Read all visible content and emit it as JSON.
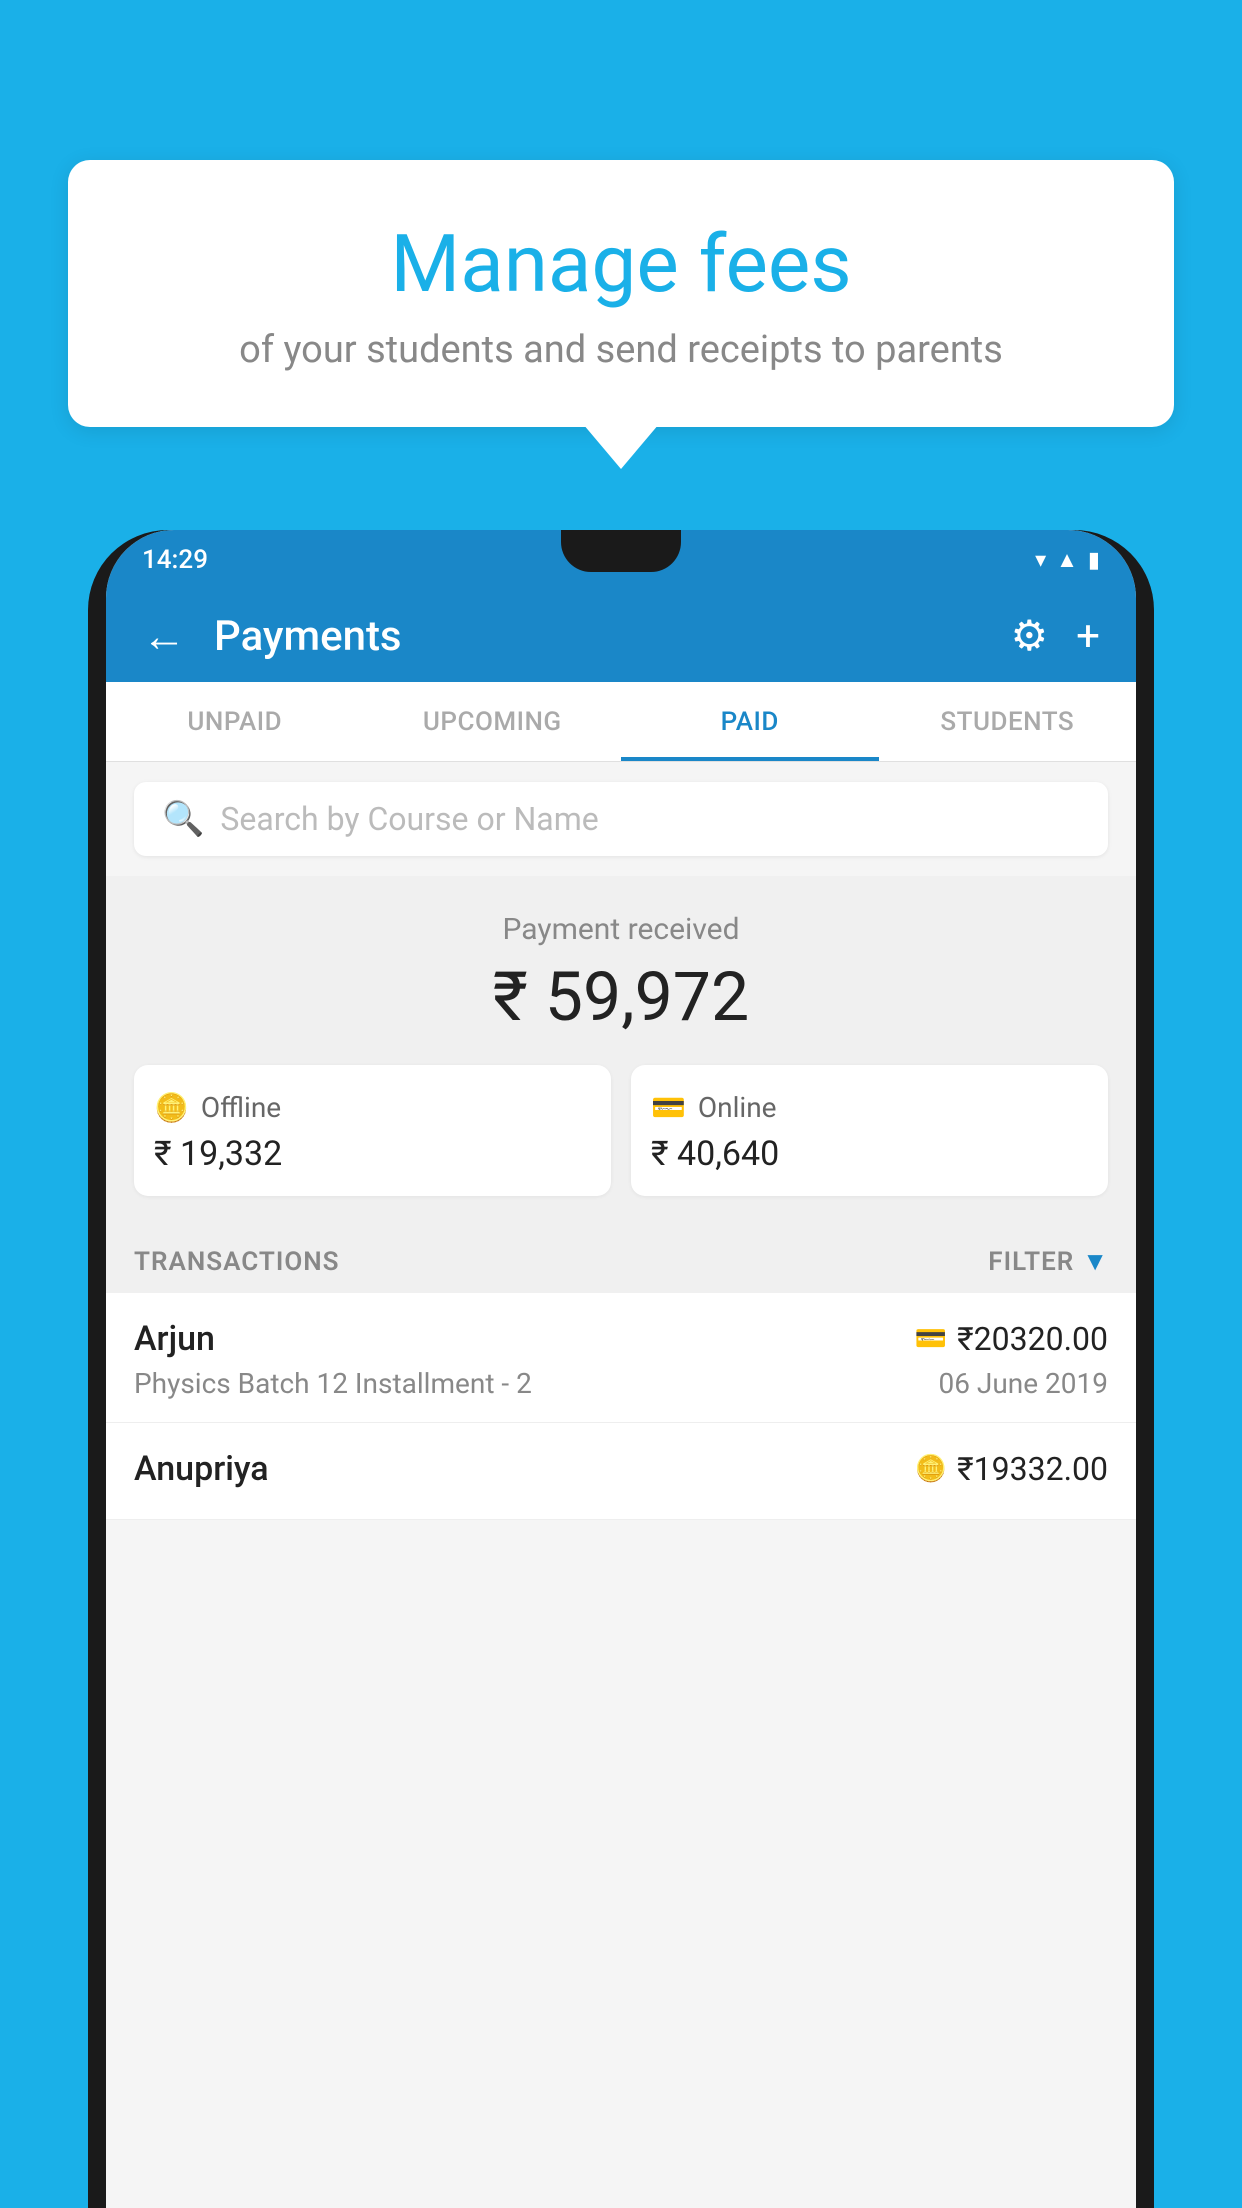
{
  "background_color": "#1ab0e8",
  "tooltip": {
    "title": "Manage fees",
    "subtitle": "of your students and send receipts to parents"
  },
  "phone": {
    "status_bar": {
      "time": "14:29",
      "icons": [
        "wifi",
        "signal",
        "battery"
      ]
    },
    "header": {
      "title": "Payments",
      "back_label": "←",
      "gear_label": "⚙",
      "plus_label": "+"
    },
    "tabs": [
      {
        "id": "unpaid",
        "label": "UNPAID",
        "active": false
      },
      {
        "id": "upcoming",
        "label": "UPCOMING",
        "active": false
      },
      {
        "id": "paid",
        "label": "PAID",
        "active": true
      },
      {
        "id": "students",
        "label": "STUDENTS",
        "active": false
      }
    ],
    "search": {
      "placeholder": "Search by Course or Name"
    },
    "payment_summary": {
      "label": "Payment received",
      "total": "₹ 59,972",
      "offline": {
        "type": "Offline",
        "amount": "₹ 19,332"
      },
      "online": {
        "type": "Online",
        "amount": "₹ 40,640"
      }
    },
    "transactions": {
      "section_label": "TRANSACTIONS",
      "filter_label": "FILTER",
      "rows": [
        {
          "name": "Arjun",
          "course": "Physics Batch 12 Installment - 2",
          "amount": "₹20320.00",
          "date": "06 June 2019",
          "type": "online"
        },
        {
          "name": "Anupriya",
          "course": "",
          "amount": "₹19332.00",
          "date": "",
          "type": "offline"
        }
      ]
    }
  }
}
